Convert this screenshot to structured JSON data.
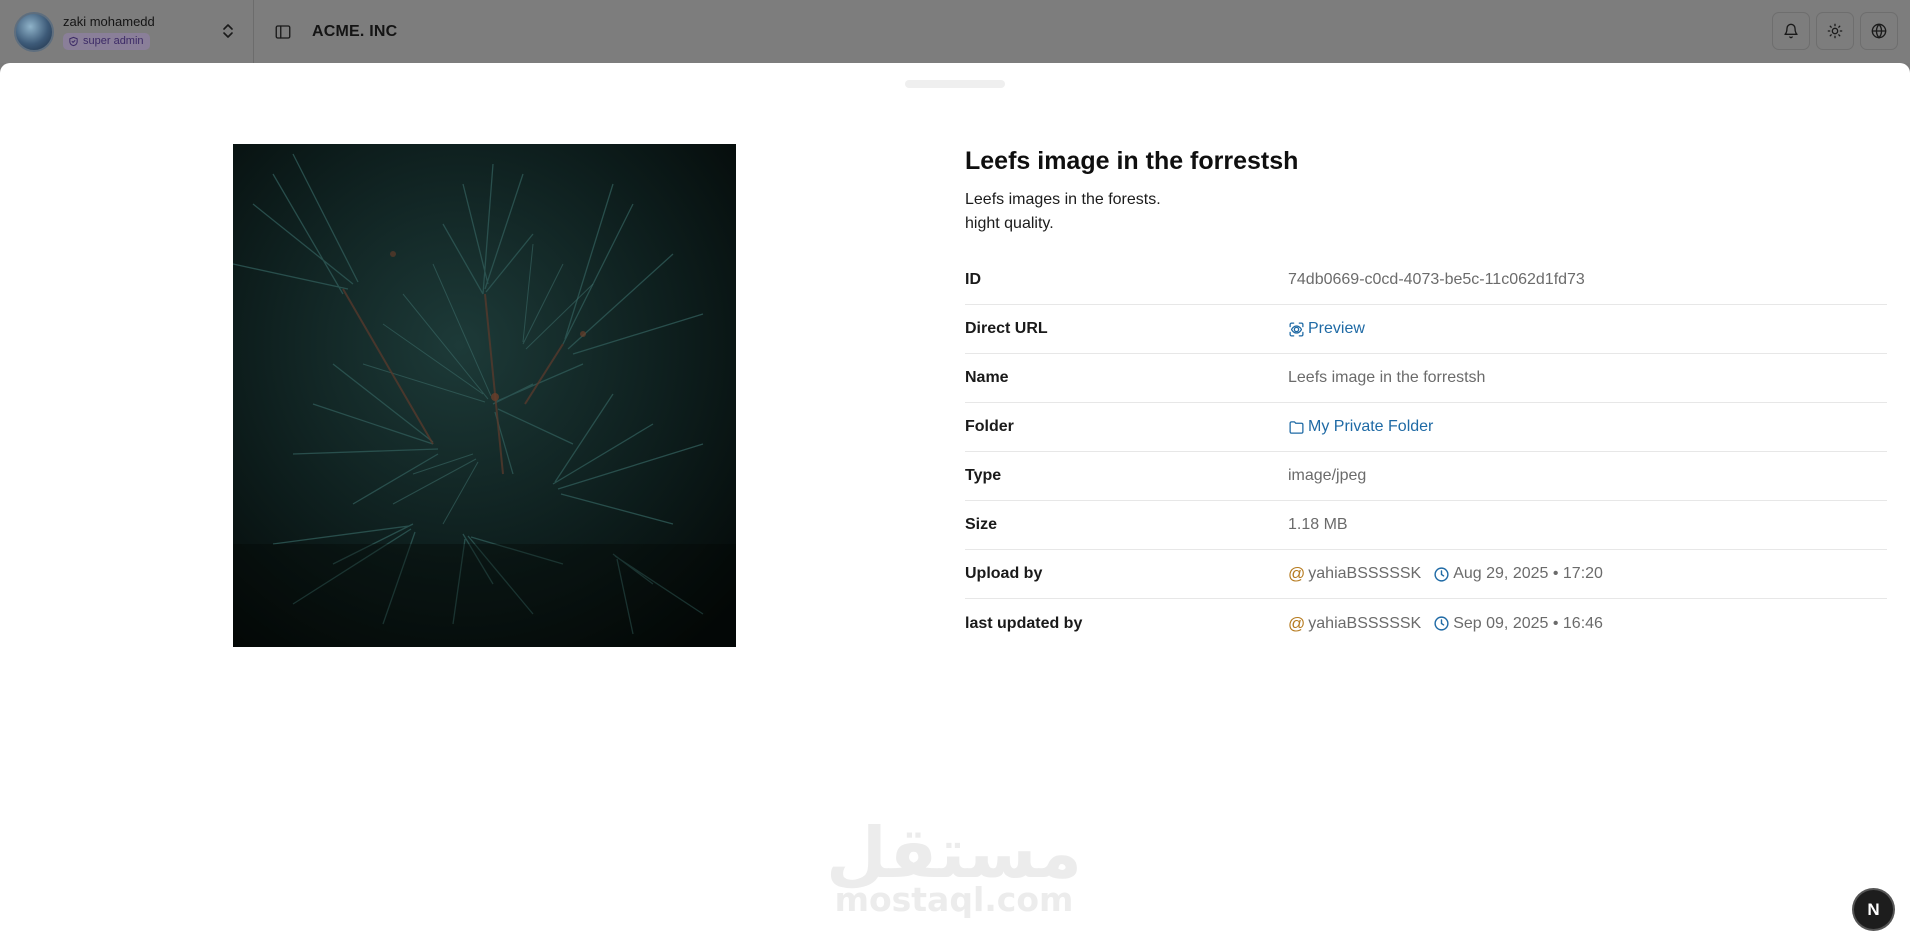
{
  "user": {
    "name": "zaki mohamedd",
    "role": "super admin"
  },
  "brand": "ACME. INC",
  "file": {
    "title": "Leefs image in the forrestsh",
    "description": "Leefs images in the forests.\nhight quality."
  },
  "meta": {
    "id_label": "ID",
    "id_value": "74db0669-c0cd-4073-be5c-11c062d1fd73",
    "url_label": "Direct URL",
    "url_value": "Preview",
    "name_label": "Name",
    "name_value": "Leefs image in the forrestsh",
    "folder_label": "Folder",
    "folder_value": "My Private Folder",
    "type_label": "Type",
    "type_value": "image/jpeg",
    "size_label": "Size",
    "size_value": "1.18 MB",
    "upload_label": "Upload by",
    "upload_user": "yahiaBSSSSSK",
    "upload_date": "Aug 29, 2025 • 17:20",
    "updated_label": "last updated by",
    "updated_user": "yahiaBSSSSSK",
    "updated_date": "Sep 09, 2025 • 16:46"
  },
  "watermark": {
    "arabic": "مستقل",
    "latin": "mostaql.com"
  },
  "corner_badge": "N",
  "colors": {
    "link": "#1f6aa5",
    "at_sign": "#b67b1f",
    "role_badge_text": "#3c2a66"
  },
  "icons": [
    "shield-icon",
    "chevron-up-down-icon",
    "sidebar-toggle-icon",
    "bell-icon",
    "sun-icon",
    "globe-icon",
    "preview-icon",
    "folder-icon",
    "at-icon",
    "clock-icon"
  ]
}
